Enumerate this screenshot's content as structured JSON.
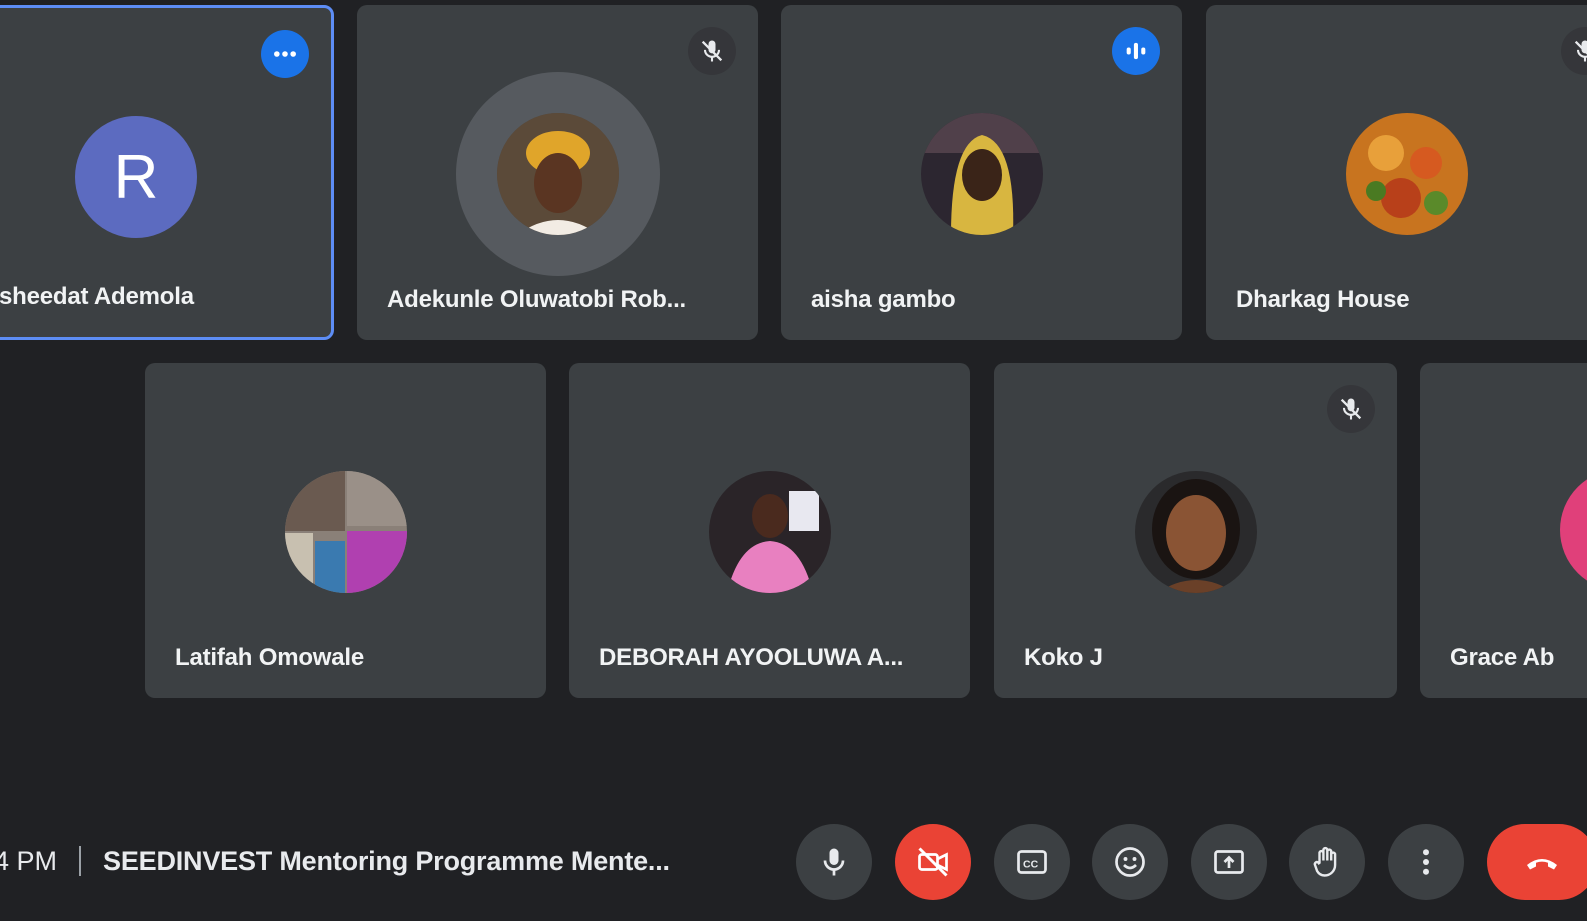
{
  "participants": [
    {
      "name": "sheedat Ademola",
      "avatar_letter": "R",
      "status_icon": "more-options-icon"
    },
    {
      "name": "Adekunle Oluwatobi Rob...",
      "status_icon": "mic-off-icon"
    },
    {
      "name": "aisha gambo",
      "status_icon": "speaking-indicator-icon"
    },
    {
      "name": "Dharkag House",
      "status_icon": "mic-off-icon"
    },
    {
      "name": "Latifah Omowale"
    },
    {
      "name": "DEBORAH AYOOLUWA A..."
    },
    {
      "name": "Koko J",
      "status_icon": "mic-off-icon"
    },
    {
      "name": "Grace Ab"
    }
  ],
  "meeting": {
    "time": "4 PM",
    "title": "SEEDINVEST Mentoring Programme Mente..."
  },
  "controls": [
    {
      "name": "microphone",
      "icon": "mic-icon"
    },
    {
      "name": "camera-off",
      "icon": "camera-off-icon"
    },
    {
      "name": "captions",
      "icon": "captions-icon"
    },
    {
      "name": "reactions",
      "icon": "emoji-icon"
    },
    {
      "name": "present-screen",
      "icon": "present-icon"
    },
    {
      "name": "raise-hand",
      "icon": "hand-icon"
    },
    {
      "name": "more-options",
      "icon": "more-vert-icon"
    },
    {
      "name": "leave-call",
      "icon": "hang-up-icon"
    }
  ],
  "colors": {
    "background": "#202124",
    "tile": "#3c4043",
    "active_border": "#5d8df5",
    "accent_blue": "#1a73e8",
    "danger_red": "#ea4335",
    "avatar_purple": "#5c6bc0"
  }
}
